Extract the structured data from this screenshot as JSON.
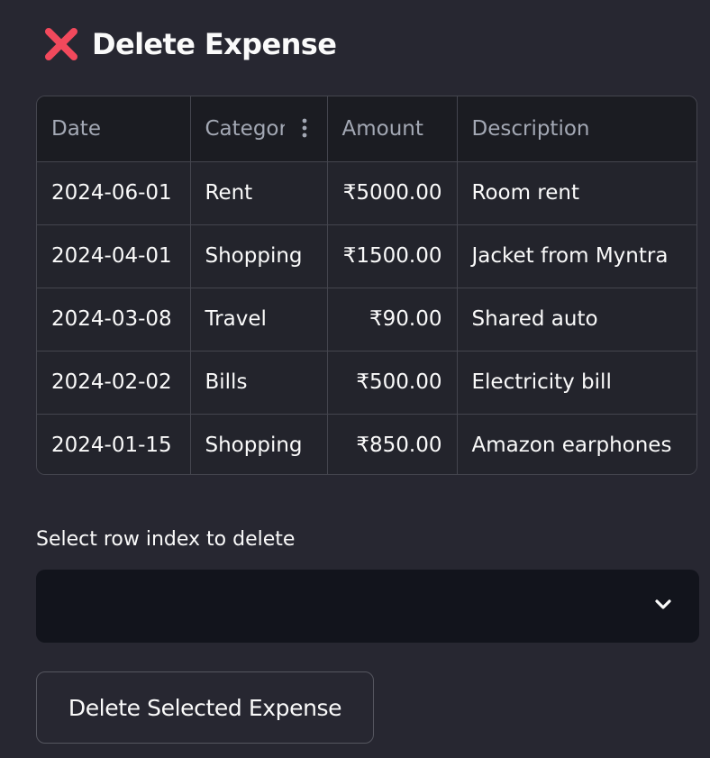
{
  "header": {
    "icon": "cross-mark-icon",
    "title": "Delete Expense"
  },
  "colors": {
    "background": "#272731",
    "cross_mark": "#f2495c",
    "grid_header": "#1b1c22",
    "grid_cell": "#23242c",
    "select_bg": "#12141c"
  },
  "table": {
    "columns": [
      "Date",
      "Category",
      "Amount",
      "Description"
    ],
    "rows": [
      [
        "2024-06-01",
        "Rent",
        "₹5000.00",
        "Room rent"
      ],
      [
        "2024-04-01",
        "Shopping",
        "₹1500.00",
        "Jacket from Myntra"
      ],
      [
        "2024-03-08",
        "Travel",
        "₹90.00",
        "Shared auto"
      ],
      [
        "2024-02-02",
        "Bills",
        "₹500.00",
        "Electricity bill"
      ],
      [
        "2024-01-15",
        "Shopping",
        "₹850.00",
        "Amazon earphones"
      ]
    ]
  },
  "select": {
    "label": "Select row index to delete",
    "value": "",
    "icon": "chevron-down-icon"
  },
  "actions": {
    "delete_label": "Delete Selected Expense"
  }
}
